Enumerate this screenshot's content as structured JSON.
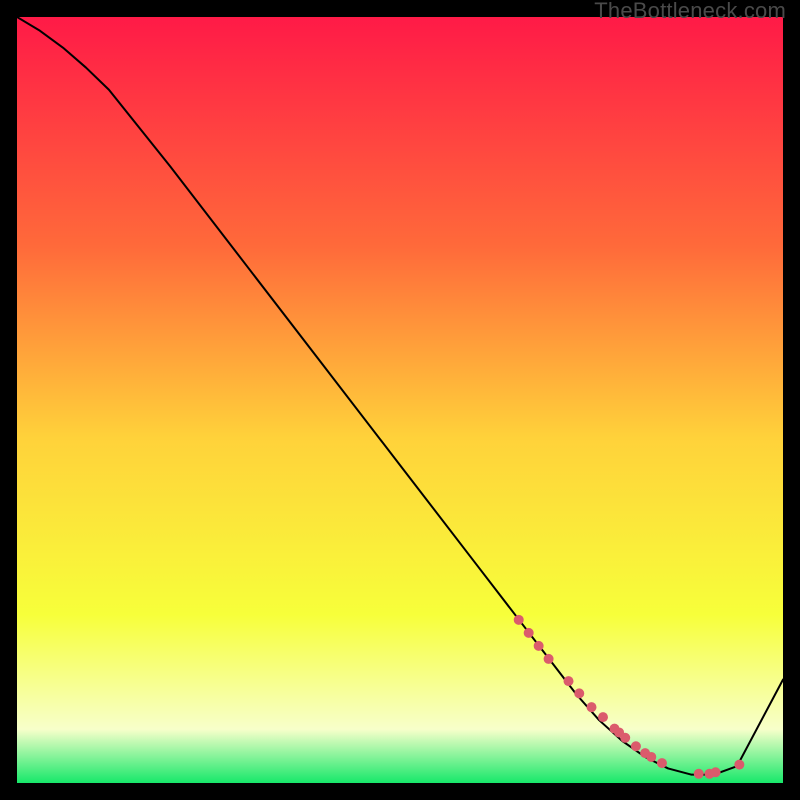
{
  "watermark_text": "TheBottleneck.com",
  "gradient": {
    "top": "#ff1a47",
    "upper_mid": "#ff6a3a",
    "mid": "#ffd23a",
    "lower_mid": "#f7ff3a",
    "near_bottom": "#f7ffca",
    "bottom": "#17e86a"
  },
  "curve_color": "#000000",
  "marker_color": "#db5b6c",
  "chart_data": {
    "type": "line",
    "title": "",
    "xlabel": "",
    "ylabel": "",
    "axes_hidden": true,
    "xlim": [
      0,
      100
    ],
    "ylim": [
      0,
      100
    ],
    "note": "Axis values are percentage of plot width/height estimated from pixel positions; the original chart has no visible ticks or labels.",
    "series": [
      {
        "name": "curve",
        "style": "line",
        "color": "#000000",
        "x": [
          0,
          3,
          6,
          9,
          12,
          20,
          30,
          40,
          50,
          60,
          66,
          70,
          73,
          76,
          79,
          82,
          85,
          88,
          91,
          94,
          100
        ],
        "y": [
          100,
          98.2,
          96,
          93.4,
          90.5,
          80.5,
          67.5,
          54.5,
          41.5,
          28.5,
          20.7,
          15.5,
          11.6,
          8.2,
          5.5,
          3.4,
          1.9,
          1.1,
          1.1,
          2.2,
          13.5
        ]
      },
      {
        "name": "markers",
        "style": "points",
        "color": "#db5b6c",
        "x": [
          65.5,
          66.8,
          68.1,
          69.4,
          72.0,
          73.4,
          75.0,
          76.5,
          78.0,
          78.6,
          79.4,
          80.8,
          82.0,
          82.8,
          84.2,
          89.0,
          90.4,
          91.2,
          94.3
        ],
        "y": [
          21.3,
          19.6,
          17.9,
          16.2,
          13.3,
          11.7,
          9.9,
          8.6,
          7.1,
          6.6,
          5.9,
          4.8,
          3.9,
          3.4,
          2.6,
          1.2,
          1.2,
          1.4,
          2.4
        ]
      }
    ]
  }
}
